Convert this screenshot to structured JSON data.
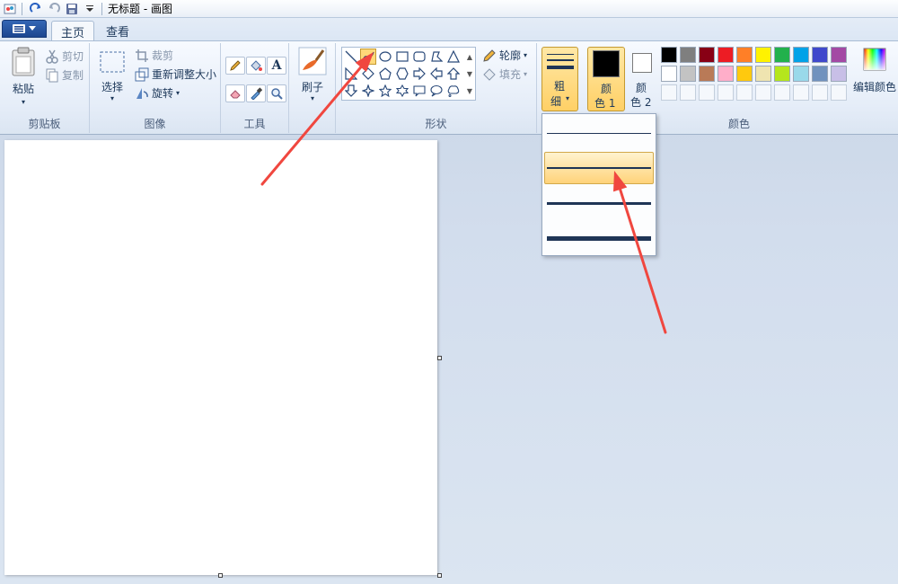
{
  "window": {
    "title": "无标题 - 画图"
  },
  "tabs": [
    {
      "label": "主页",
      "active": true
    },
    {
      "label": "查看",
      "active": false
    }
  ],
  "clipboard": {
    "paste": "粘贴",
    "cut": "剪切",
    "copy": "复制",
    "group": "剪贴板"
  },
  "image": {
    "select": "选择",
    "crop": "裁剪",
    "resize": "重新调整大小",
    "rotate": "旋转",
    "group": "图像"
  },
  "tools": {
    "group": "工具"
  },
  "brushes": {
    "label": "刷子"
  },
  "shapes": {
    "outline": "轮廓",
    "fill": "填充",
    "group": "形状",
    "selected": "curve"
  },
  "size": {
    "label1": "粗",
    "label2": "细"
  },
  "colors": {
    "color1_l1": "颜",
    "color1_l2": "色 1",
    "color2_l1": "颜",
    "color2_l2": "色 2",
    "edit": "编辑颜色",
    "group": "颜色",
    "color1": "#000000",
    "color2": "#ffffff",
    "palette_row1": [
      "#000000",
      "#7f7f7f",
      "#880015",
      "#ed1c24",
      "#ff7f27",
      "#fff200",
      "#22b14c",
      "#00a2e8",
      "#3f48cc",
      "#a349a4"
    ],
    "palette_row2": [
      "#ffffff",
      "#c3c3c3",
      "#b97a57",
      "#ffaec9",
      "#ffc90e",
      "#efe4b0",
      "#b5e61d",
      "#99d9ea",
      "#7092be",
      "#c8bfe7"
    ]
  },
  "size_dropdown": {
    "options": [
      1,
      3,
      5,
      8
    ],
    "highlighted_index": 1
  },
  "accent": {
    "highlight": "#ffd37a",
    "arrow": "#f0473f"
  }
}
